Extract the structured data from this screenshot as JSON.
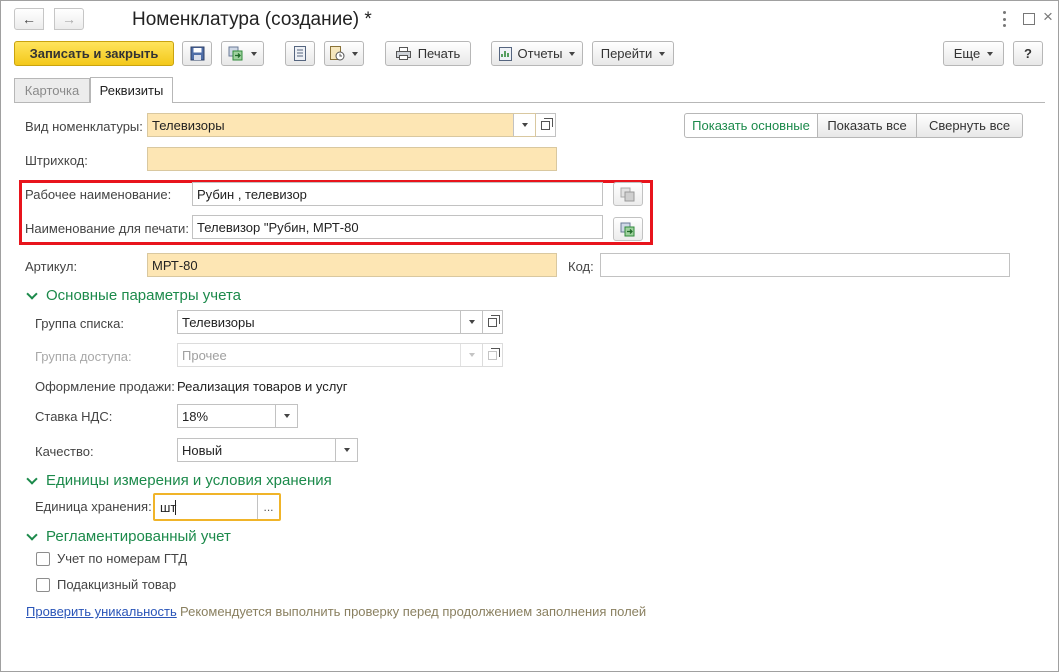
{
  "window": {
    "title": "Номенклатура (создание) *"
  },
  "toolbar": {
    "save_close": "Записать и закрыть",
    "print": "Печать",
    "reports": "Отчеты",
    "goto": "Перейти",
    "more": "Еще",
    "help": "?"
  },
  "tabs": [
    {
      "label": "Карточка",
      "active": false
    },
    {
      "label": "Реквизиты",
      "active": true
    }
  ],
  "view_buttons": {
    "show_main": "Показать основные",
    "show_all": "Показать все",
    "collapse_all": "Свернуть все"
  },
  "fields": {
    "kind": {
      "label": "Вид номенклатуры:",
      "value": "Телевизоры"
    },
    "barcode": {
      "label": "Штрихкод:",
      "value": ""
    },
    "work_name": {
      "label": "Рабочее наименование:",
      "value": "Рубин , телевизор"
    },
    "print_name": {
      "label": "Наименование для печати:",
      "value": "Телевизор \"Рубин, МРТ-80"
    },
    "article": {
      "label": "Артикул:",
      "value": "МРТ-80"
    },
    "code": {
      "label": "Код:",
      "value": ""
    }
  },
  "sections": {
    "accounting": {
      "title": "Основные параметры учета",
      "list_group": {
        "label": "Группа списка:",
        "value": "Телевизоры"
      },
      "access_group": {
        "label": "Группа доступа:",
        "value": "Прочее"
      },
      "sales_design": {
        "label": "Оформление продажи:",
        "value": "Реализация товаров и услуг"
      },
      "vat": {
        "label": "Ставка НДС:",
        "value": "18%"
      },
      "quality": {
        "label": "Качество:",
        "value": "Новый"
      }
    },
    "units": {
      "title": "Единицы измерения и условия хранения",
      "storage_unit": {
        "label": "Единица хранения:",
        "value": "шт",
        "button": "..."
      }
    },
    "regulated": {
      "title": "Регламентированный учет",
      "gtd": {
        "label": "Учет по номерам ГТД",
        "checked": false
      },
      "excise": {
        "label": "Подакцизный товар",
        "checked": false
      }
    }
  },
  "footer": {
    "check_link": "Проверить уникальность",
    "hint": "Рекомендуется выполнить проверку перед продолжением заполнения полей"
  },
  "colors": {
    "accent_green": "#1c8a4b",
    "required_bg": "#fde6b4",
    "highlight_red": "#e8141c",
    "focus_orange": "#f0b429"
  }
}
